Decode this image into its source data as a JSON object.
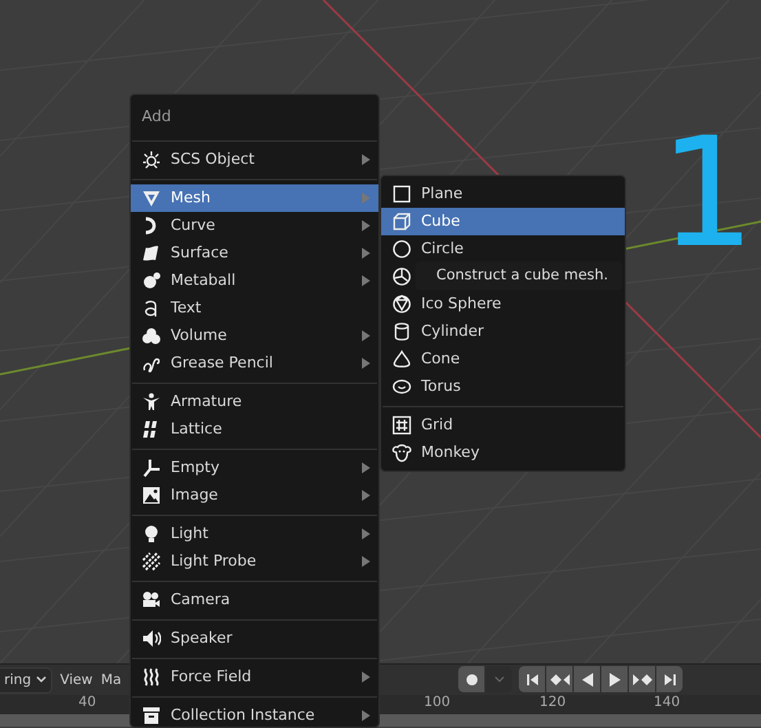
{
  "add_menu": {
    "title": "Add",
    "sections": [
      [
        {
          "label": "SCS Object",
          "submenu": true,
          "selected": false
        }
      ],
      [
        {
          "label": "Mesh",
          "submenu": true,
          "selected": true
        },
        {
          "label": "Curve",
          "submenu": true,
          "selected": false
        },
        {
          "label": "Surface",
          "submenu": true,
          "selected": false
        },
        {
          "label": "Metaball",
          "submenu": true,
          "selected": false
        },
        {
          "label": "Text",
          "submenu": false,
          "selected": false
        },
        {
          "label": "Volume",
          "submenu": true,
          "selected": false
        },
        {
          "label": "Grease Pencil",
          "submenu": true,
          "selected": false
        }
      ],
      [
        {
          "label": "Armature",
          "submenu": false,
          "selected": false
        },
        {
          "label": "Lattice",
          "submenu": false,
          "selected": false
        }
      ],
      [
        {
          "label": "Empty",
          "submenu": true,
          "selected": false
        },
        {
          "label": "Image",
          "submenu": true,
          "selected": false
        }
      ],
      [
        {
          "label": "Light",
          "submenu": true,
          "selected": false
        },
        {
          "label": "Light Probe",
          "submenu": true,
          "selected": false
        }
      ],
      [
        {
          "label": "Camera",
          "submenu": false,
          "selected": false
        }
      ],
      [
        {
          "label": "Speaker",
          "submenu": false,
          "selected": false
        }
      ],
      [
        {
          "label": "Force Field",
          "submenu": true,
          "selected": false
        }
      ],
      [
        {
          "label": "Collection Instance",
          "submenu": true,
          "selected": false
        }
      ]
    ]
  },
  "mesh_submenu": {
    "sections": [
      [
        {
          "label": "Plane",
          "selected": false
        },
        {
          "label": "Cube",
          "selected": true
        },
        {
          "label": "Circle",
          "selected": false
        },
        {
          "selected": false
        },
        {
          "label": "Ico Sphere",
          "selected": false
        },
        {
          "label": "Cylinder",
          "selected": false
        },
        {
          "label": "Cone",
          "selected": false
        },
        {
          "label": "Torus",
          "selected": false
        }
      ],
      [
        {
          "label": "Grid",
          "selected": false
        },
        {
          "label": "Monkey",
          "selected": false
        }
      ]
    ]
  },
  "tooltip": "Construct a cube mesh.",
  "annotation": "1",
  "timeline": {
    "dropdown": "ring",
    "menus": [
      "View",
      "Ma"
    ],
    "ruler": [
      "40",
      "100",
      "120",
      "140"
    ]
  }
}
